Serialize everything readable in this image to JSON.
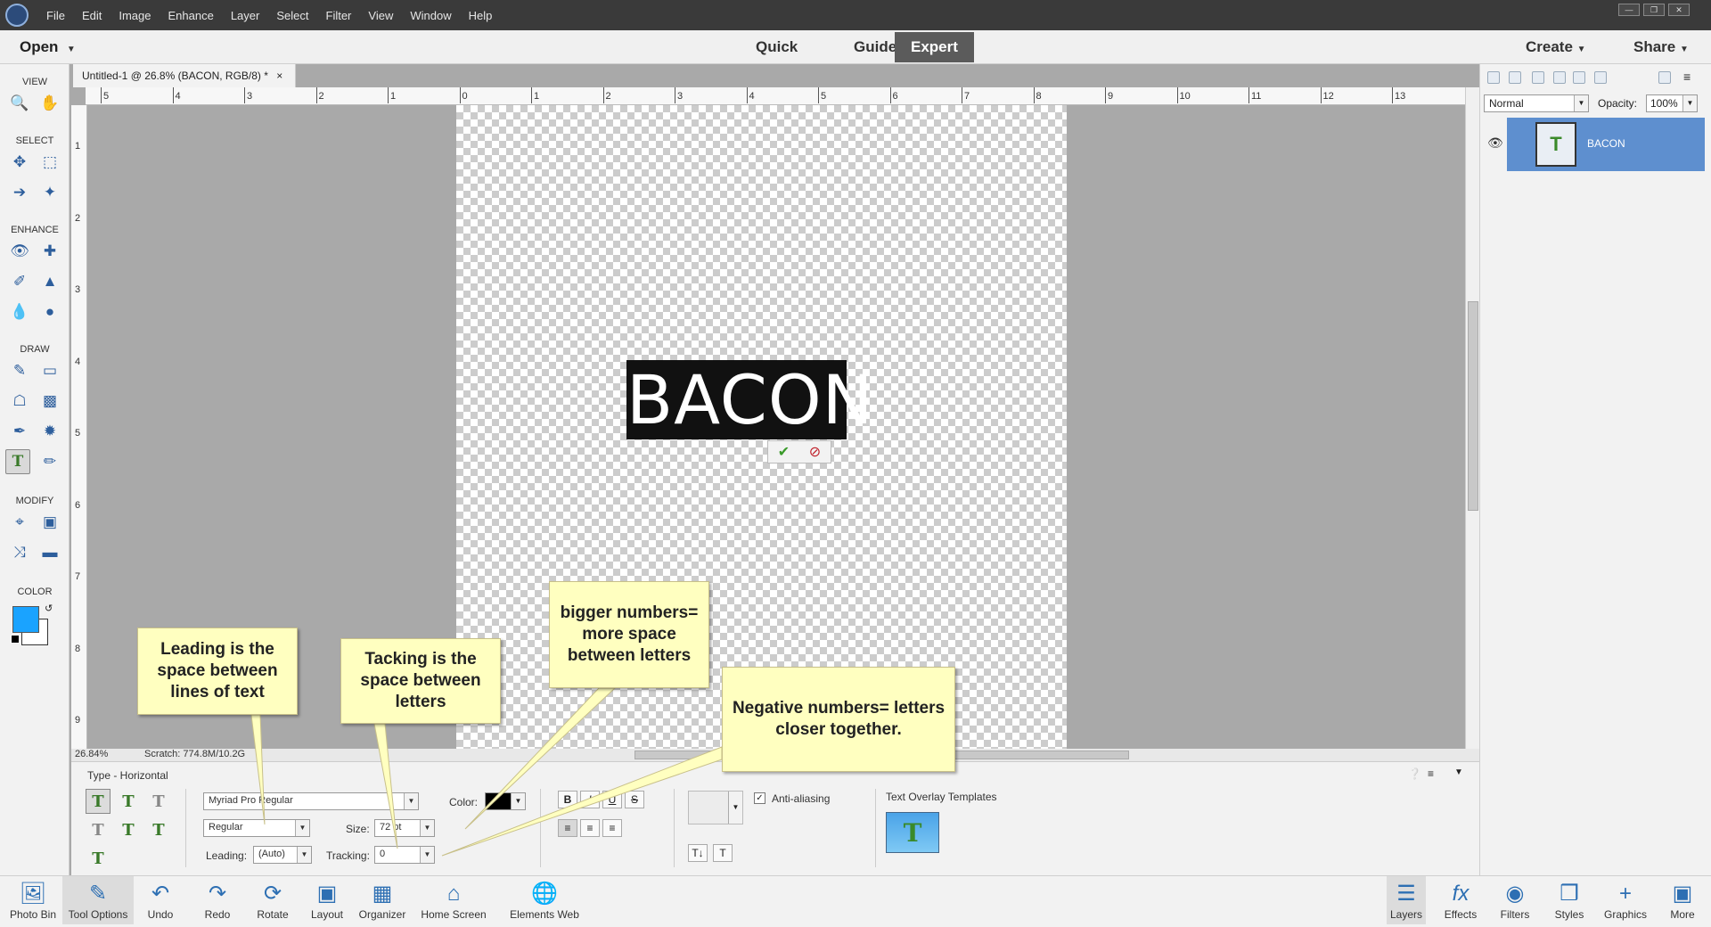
{
  "menubar": {
    "items": [
      "File",
      "Edit",
      "Image",
      "Enhance",
      "Layer",
      "Select",
      "Filter",
      "View",
      "Window",
      "Help"
    ]
  },
  "modebar": {
    "open_label": "Open",
    "modes": [
      "Quick",
      "Guided",
      "Expert"
    ],
    "active_mode": "Expert",
    "create_label": "Create",
    "share_label": "Share"
  },
  "toolbox": {
    "sections": [
      "VIEW",
      "SELECT",
      "ENHANCE",
      "DRAW",
      "MODIFY",
      "COLOR"
    ],
    "foreground_color": "#1aa3ff",
    "background_color": "#ffffff"
  },
  "document": {
    "tab_title": "Untitled-1 @ 26.8% (BACON, RGB/8) *",
    "text_content": "BACON",
    "zoom": "26.84%",
    "scratch": "Scratch: 774.8M/10.2G"
  },
  "rulers": {
    "top": [
      "5",
      "4",
      "3",
      "2",
      "1",
      "0",
      "1",
      "2",
      "3",
      "4",
      "5",
      "6",
      "7",
      "8",
      "9",
      "10",
      "11",
      "12",
      "13"
    ],
    "left": [
      "1",
      "2",
      "3",
      "4",
      "5",
      "6",
      "7",
      "8",
      "9"
    ]
  },
  "layers_panel": {
    "blend_mode": "Normal",
    "opacity_label": "Opacity:",
    "opacity_value": "100%",
    "layer_name": "BACON"
  },
  "tool_options": {
    "title": "Type - Horizontal",
    "font_family": "Myriad Pro Regular",
    "font_style": "Regular",
    "size_label": "Size:",
    "size_value": "72 pt",
    "leading_label": "Leading:",
    "leading_value": "(Auto)",
    "tracking_label": "Tracking:",
    "tracking_value": "0",
    "color_label": "Color:",
    "anti_aliasing_label": "Anti-aliasing",
    "anti_aliasing_checked": true,
    "overlay_templates_label": "Text Overlay Templates"
  },
  "bottombar": {
    "left": [
      "Photo Bin",
      "Tool Options",
      "Undo",
      "Redo",
      "Rotate",
      "Layout",
      "Organizer",
      "Home Screen",
      "Elements Web"
    ],
    "right": [
      "Layers",
      "Effects",
      "Filters",
      "Styles",
      "Graphics",
      "More"
    ]
  },
  "callouts": {
    "leading": "Leading is the space between lines of text",
    "tracking": "Tacking is the space between letters",
    "bigger": "bigger numbers= more space between letters",
    "negative": "Negative numbers= letters closer together."
  }
}
